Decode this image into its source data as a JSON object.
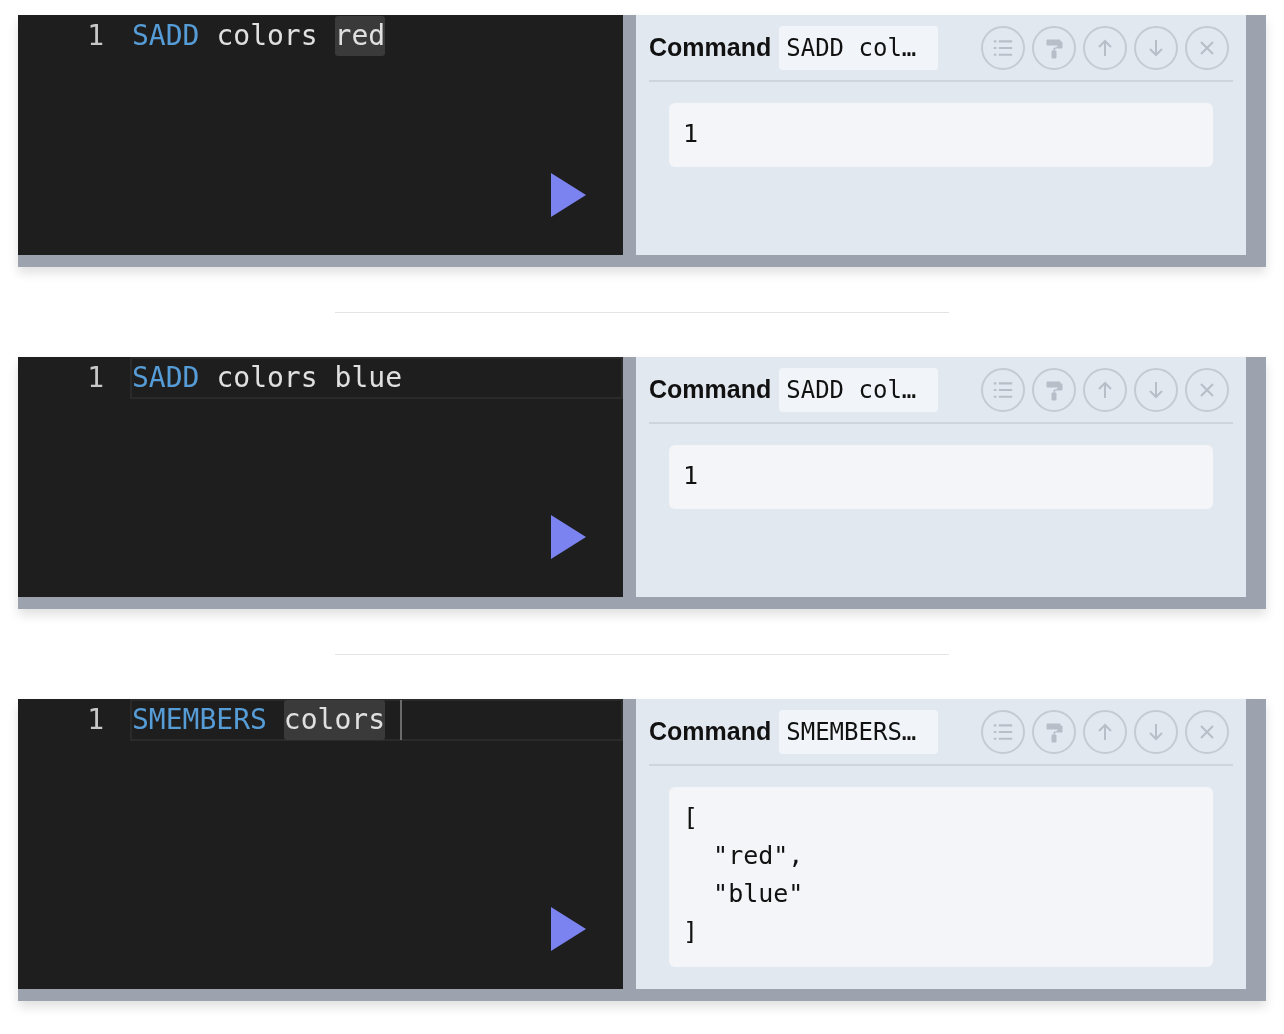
{
  "cells": [
    {
      "line_number": "1",
      "active_line": false,
      "cursor": false,
      "tokens": [
        {
          "kind": "keyword",
          "text": "SADD",
          "highlighted": false
        },
        {
          "kind": "text",
          "text": "colors",
          "highlighted": false
        },
        {
          "kind": "text",
          "text": "red",
          "highlighted": true
        }
      ],
      "label": "Command",
      "command": "SADD col…",
      "output": "1"
    },
    {
      "line_number": "1",
      "active_line": true,
      "cursor": false,
      "tokens": [
        {
          "kind": "keyword",
          "text": "SADD",
          "highlighted": false
        },
        {
          "kind": "text",
          "text": "colors",
          "highlighted": false
        },
        {
          "kind": "text",
          "text": "blue",
          "highlighted": false
        }
      ],
      "label": "Command",
      "command": "SADD col…",
      "output": "1"
    },
    {
      "line_number": "1",
      "active_line": true,
      "cursor": true,
      "tokens": [
        {
          "kind": "keyword",
          "text": "SMEMBERS",
          "highlighted": false
        },
        {
          "kind": "text",
          "text": "colors",
          "highlighted": true
        }
      ],
      "label": "Command",
      "command": "SMEMBERS…",
      "output": "[\n  \"red\",\n  \"blue\"\n]"
    }
  ]
}
